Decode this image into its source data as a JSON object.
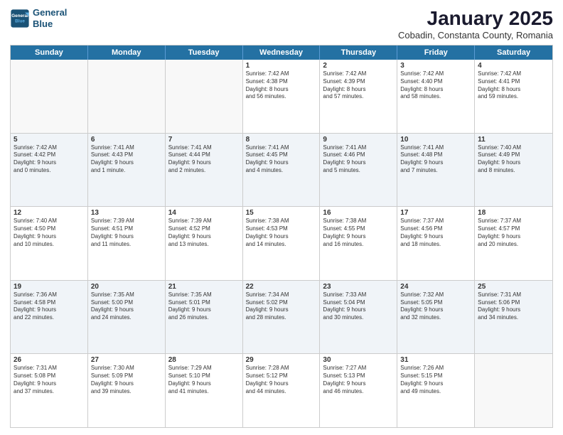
{
  "header": {
    "logo_line1": "General",
    "logo_line2": "Blue",
    "month": "January 2025",
    "location": "Cobadin, Constanta County, Romania"
  },
  "weekdays": [
    "Sunday",
    "Monday",
    "Tuesday",
    "Wednesday",
    "Thursday",
    "Friday",
    "Saturday"
  ],
  "rows": [
    [
      {
        "day": "",
        "text": ""
      },
      {
        "day": "",
        "text": ""
      },
      {
        "day": "",
        "text": ""
      },
      {
        "day": "1",
        "text": "Sunrise: 7:42 AM\nSunset: 4:38 PM\nDaylight: 8 hours\nand 56 minutes."
      },
      {
        "day": "2",
        "text": "Sunrise: 7:42 AM\nSunset: 4:39 PM\nDaylight: 8 hours\nand 57 minutes."
      },
      {
        "day": "3",
        "text": "Sunrise: 7:42 AM\nSunset: 4:40 PM\nDaylight: 8 hours\nand 58 minutes."
      },
      {
        "day": "4",
        "text": "Sunrise: 7:42 AM\nSunset: 4:41 PM\nDaylight: 8 hours\nand 59 minutes."
      }
    ],
    [
      {
        "day": "5",
        "text": "Sunrise: 7:42 AM\nSunset: 4:42 PM\nDaylight: 9 hours\nand 0 minutes."
      },
      {
        "day": "6",
        "text": "Sunrise: 7:41 AM\nSunset: 4:43 PM\nDaylight: 9 hours\nand 1 minute."
      },
      {
        "day": "7",
        "text": "Sunrise: 7:41 AM\nSunset: 4:44 PM\nDaylight: 9 hours\nand 2 minutes."
      },
      {
        "day": "8",
        "text": "Sunrise: 7:41 AM\nSunset: 4:45 PM\nDaylight: 9 hours\nand 4 minutes."
      },
      {
        "day": "9",
        "text": "Sunrise: 7:41 AM\nSunset: 4:46 PM\nDaylight: 9 hours\nand 5 minutes."
      },
      {
        "day": "10",
        "text": "Sunrise: 7:41 AM\nSunset: 4:48 PM\nDaylight: 9 hours\nand 7 minutes."
      },
      {
        "day": "11",
        "text": "Sunrise: 7:40 AM\nSunset: 4:49 PM\nDaylight: 9 hours\nand 8 minutes."
      }
    ],
    [
      {
        "day": "12",
        "text": "Sunrise: 7:40 AM\nSunset: 4:50 PM\nDaylight: 9 hours\nand 10 minutes."
      },
      {
        "day": "13",
        "text": "Sunrise: 7:39 AM\nSunset: 4:51 PM\nDaylight: 9 hours\nand 11 minutes."
      },
      {
        "day": "14",
        "text": "Sunrise: 7:39 AM\nSunset: 4:52 PM\nDaylight: 9 hours\nand 13 minutes."
      },
      {
        "day": "15",
        "text": "Sunrise: 7:38 AM\nSunset: 4:53 PM\nDaylight: 9 hours\nand 14 minutes."
      },
      {
        "day": "16",
        "text": "Sunrise: 7:38 AM\nSunset: 4:55 PM\nDaylight: 9 hours\nand 16 minutes."
      },
      {
        "day": "17",
        "text": "Sunrise: 7:37 AM\nSunset: 4:56 PM\nDaylight: 9 hours\nand 18 minutes."
      },
      {
        "day": "18",
        "text": "Sunrise: 7:37 AM\nSunset: 4:57 PM\nDaylight: 9 hours\nand 20 minutes."
      }
    ],
    [
      {
        "day": "19",
        "text": "Sunrise: 7:36 AM\nSunset: 4:58 PM\nDaylight: 9 hours\nand 22 minutes."
      },
      {
        "day": "20",
        "text": "Sunrise: 7:35 AM\nSunset: 5:00 PM\nDaylight: 9 hours\nand 24 minutes."
      },
      {
        "day": "21",
        "text": "Sunrise: 7:35 AM\nSunset: 5:01 PM\nDaylight: 9 hours\nand 26 minutes."
      },
      {
        "day": "22",
        "text": "Sunrise: 7:34 AM\nSunset: 5:02 PM\nDaylight: 9 hours\nand 28 minutes."
      },
      {
        "day": "23",
        "text": "Sunrise: 7:33 AM\nSunset: 5:04 PM\nDaylight: 9 hours\nand 30 minutes."
      },
      {
        "day": "24",
        "text": "Sunrise: 7:32 AM\nSunset: 5:05 PM\nDaylight: 9 hours\nand 32 minutes."
      },
      {
        "day": "25",
        "text": "Sunrise: 7:31 AM\nSunset: 5:06 PM\nDaylight: 9 hours\nand 34 minutes."
      }
    ],
    [
      {
        "day": "26",
        "text": "Sunrise: 7:31 AM\nSunset: 5:08 PM\nDaylight: 9 hours\nand 37 minutes."
      },
      {
        "day": "27",
        "text": "Sunrise: 7:30 AM\nSunset: 5:09 PM\nDaylight: 9 hours\nand 39 minutes."
      },
      {
        "day": "28",
        "text": "Sunrise: 7:29 AM\nSunset: 5:10 PM\nDaylight: 9 hours\nand 41 minutes."
      },
      {
        "day": "29",
        "text": "Sunrise: 7:28 AM\nSunset: 5:12 PM\nDaylight: 9 hours\nand 44 minutes."
      },
      {
        "day": "30",
        "text": "Sunrise: 7:27 AM\nSunset: 5:13 PM\nDaylight: 9 hours\nand 46 minutes."
      },
      {
        "day": "31",
        "text": "Sunrise: 7:26 AM\nSunset: 5:15 PM\nDaylight: 9 hours\nand 49 minutes."
      },
      {
        "day": "",
        "text": ""
      }
    ]
  ]
}
